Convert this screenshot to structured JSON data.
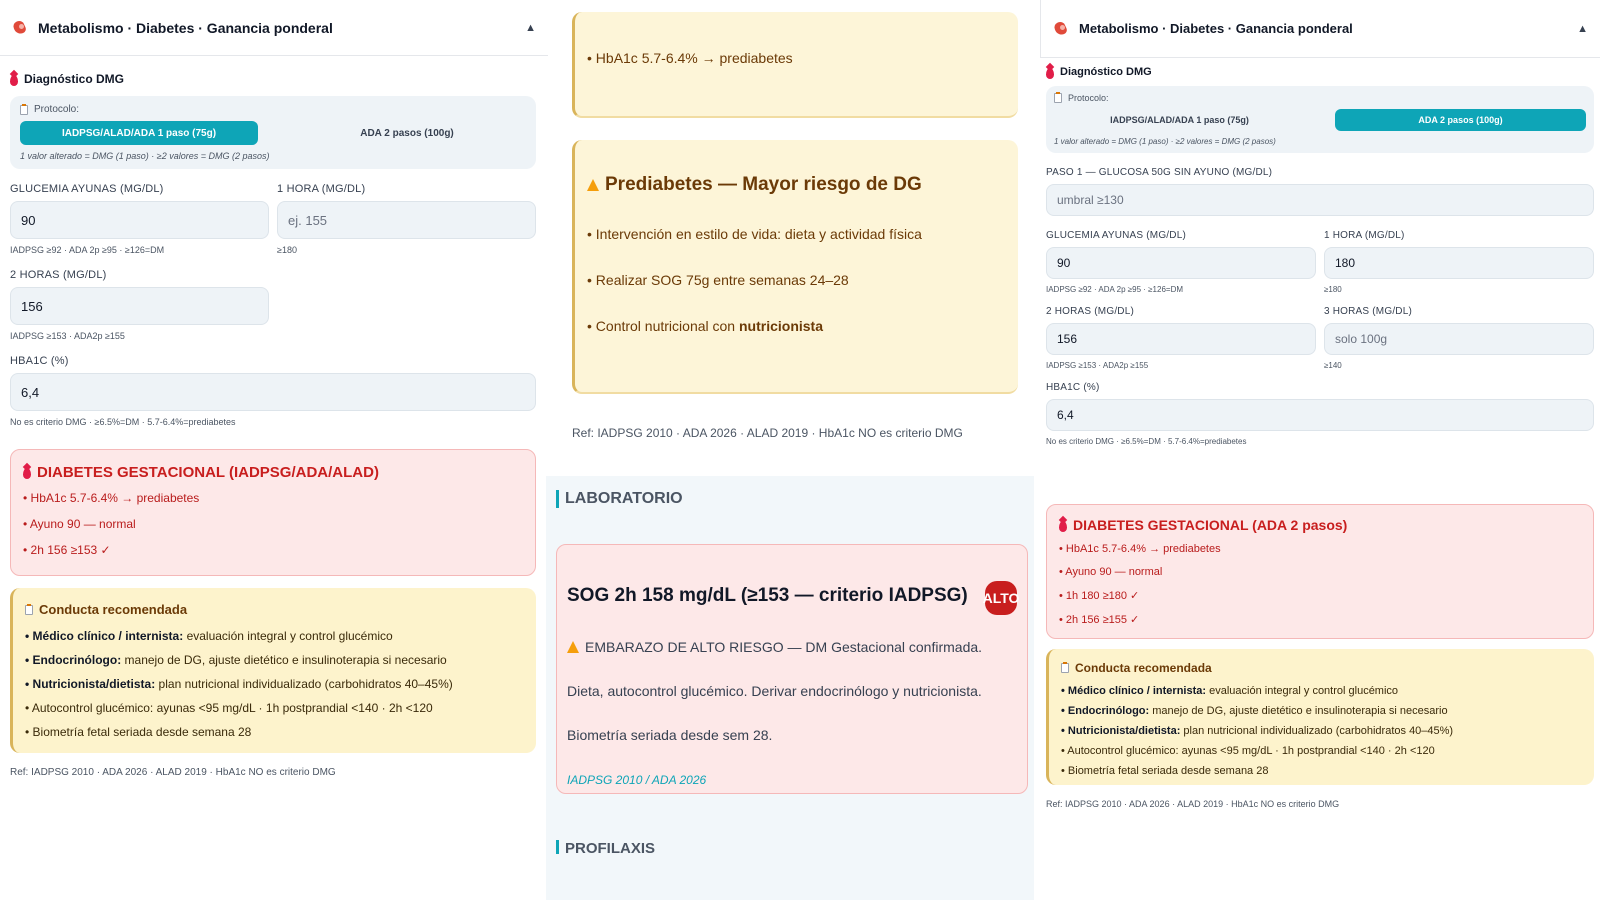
{
  "panel1": {
    "header_title": "Metabolismo · Diabetes · Ganancia ponderal",
    "caret": "▲",
    "section_title": "Diagnóstico DMG",
    "protocol_label": "Protocolo:",
    "protocol_options": [
      "IADPSG/ALAD/ADA 1 paso (75g)",
      "ADA 2 pasos (100g)"
    ],
    "protocol_note": "1 valor alterado = DMG (1 paso) · ≥2 valores = DMG (2 pasos)",
    "fasting_label": "GLUCEMIA AYUNAS (MG/DL)",
    "fasting_value": "90",
    "fasting_hint": "IADPSG ≥92 · ADA 2p ≥95 · ≥126=DM",
    "h1_label": "1 HORA (MG/DL)",
    "h1_placeholder": "ej. 155",
    "h1_hint": "≥180",
    "h2_label": "2 HORAS (MG/DL)",
    "h2_value": "156",
    "h2_hint": "IADPSG ≥153 · ADA2p ≥155",
    "hba1c_label": "HBA1C (%)",
    "hba1c_value": "6,4",
    "hba1c_hint": "No es criterio DMG · ≥6.5%=DM · 5.7-6.4%=prediabetes",
    "alert_title": "DIABETES GESTACIONAL (IADPSG/ADA/ALAD)",
    "alert_items": [
      "• HbA1c 5.7-6.4% → prediabetes",
      "• Ayuno 90 — normal",
      "• 2h 156 ≥153 ✓"
    ],
    "conduct_title": "Conducta recomendada",
    "conduct_items": [
      {
        "bold": "• Médico clínico / internista:",
        "text": " evaluación integral y control glucémico"
      },
      {
        "bold": "• Endocrinólogo:",
        "text": " manejo de DG, ajuste dietético e insulinoterapia si necesario"
      },
      {
        "bold": "• Nutricionista/dietista:",
        "text": " plan nutricional individualizado (carbohidratos 40–45%)"
      },
      {
        "bold": "",
        "text": "• Autocontrol glucémico: ayunas <95 mg/dL · 1h postprandial <140 · 2h <120"
      },
      {
        "bold": "",
        "text": "• Biometría fetal seriada desde semana 28"
      }
    ],
    "ref": "Ref: IADPSG 2010 · ADA 2026 · ALAD 2019 · HbA1c NO es criterio DMG"
  },
  "panel2": {
    "top_item": "• HbA1c 5.7-6.4% → prediabetes",
    "pre_title": "Prediabetes — Mayor riesgo de DG",
    "pre_items": [
      "• Intervención en estilo de vida: dieta y actividad física",
      "• Realizar SOG 75g entre semanas 24–28"
    ],
    "pre_last_prefix": "• Control nutricional con ",
    "pre_last_bold": "nutricionista",
    "ref": "Ref: IADPSG 2010 · ADA 2026 · ALAD 2019 · HbA1c NO es criterio DMG",
    "lab_section": "LABORATORIO",
    "lab_title": "SOG 2h 158 mg/dL (≥153 — criterio IADPSG)",
    "lab_badge": "ALTO",
    "lab_text": "EMBARAZO DE ALTO RIESGO — DM Gestacional confirmada. Dieta, autocontrol glucémico. Derivar endocrinólogo y nutricionista. Biometría seriada desde sem 28.",
    "lab_ref": "IADPSG 2010 / ADA 2026",
    "next_section": "PROFILAXIS"
  },
  "panel3": {
    "header_title": "Metabolismo · Diabetes · Ganancia ponderal",
    "caret": "▲",
    "section_title": "Diagnóstico DMG",
    "protocol_label": "Protocolo:",
    "protocol_options": [
      "IADPSG/ALAD/ADA 1 paso (75g)",
      "ADA 2 pasos (100g)"
    ],
    "protocol_note": "1 valor alterado = DMG (1 paso) · ≥2 valores = DMG (2 pasos)",
    "step1_label": "PASO 1 — GLUCOSA 50G SIN AYUNO (MG/DL)",
    "step1_placeholder": "umbral ≥130",
    "fasting_label": "GLUCEMIA AYUNAS (MG/DL)",
    "fasting_value": "90",
    "fasting_hint": "IADPSG ≥92 · ADA 2p ≥95 · ≥126=DM",
    "h1_label": "1 HORA (MG/DL)",
    "h1_value": "180",
    "h1_hint": "≥180",
    "h2_label": "2 HORAS (MG/DL)",
    "h2_value": "156",
    "h2_hint": "IADPSG ≥153 · ADA2p ≥155",
    "h3_label": "3 HORAS (MG/DL)",
    "h3_placeholder": "solo 100g",
    "h3_hint": "≥140",
    "hba1c_label": "HBA1C (%)",
    "hba1c_value": "6,4",
    "hba1c_hint": "No es criterio DMG · ≥6.5%=DM · 5.7-6.4%=prediabetes",
    "alert_title": "DIABETES GESTACIONAL (ADA 2 pasos)",
    "alert_items": [
      "• HbA1c 5.7-6.4% → prediabetes",
      "• Ayuno 90 — normal",
      "• 1h 180 ≥180 ✓",
      "• 2h 156 ≥155 ✓"
    ],
    "conduct_title": "Conducta recomendada",
    "conduct_items": [
      {
        "bold": "• Médico clínico / internista:",
        "text": " evaluación integral y control glucémico"
      },
      {
        "bold": "• Endocrinólogo:",
        "text": " manejo de DG, ajuste dietético e insulinoterapia si necesario"
      },
      {
        "bold": "• Nutricionista/dietista:",
        "text": " plan nutricional individualizado (carbohidratos 40–45%)"
      },
      {
        "bold": "",
        "text": "• Autocontrol glucémico: ayunas <95 mg/dL · 1h postprandial <140 · 2h <120"
      },
      {
        "bold": "",
        "text": "• Biometría fetal seriada desde semana 28"
      }
    ],
    "ref": "Ref: IADPSG 2010 · ADA 2026 · ALAD 2019 · HbA1c NO es criterio DMG"
  },
  "colors": {
    "accent": "#0ea5b7",
    "alert": "#c81e1e",
    "warn": "#f59e0b"
  }
}
